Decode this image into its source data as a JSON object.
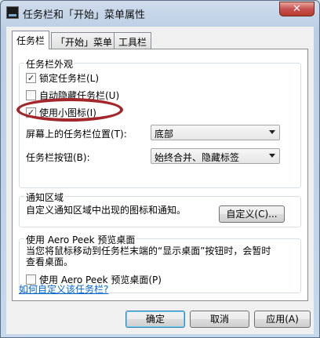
{
  "window": {
    "title": "任务栏和「开始」菜单属性",
    "close_glyph": "✕"
  },
  "tabs": [
    {
      "label": "任务栏"
    },
    {
      "label": "「开始」菜单"
    },
    {
      "label": "工具栏"
    }
  ],
  "appearance": {
    "legend": "任务栏外观",
    "lock_label": "锁定任务栏(L)",
    "lock_checked": true,
    "autohide_label": "自动隐藏任务栏(U)",
    "autohide_checked": false,
    "small_icons_label": "使用小图标(I)",
    "small_icons_checked": true,
    "position_label": "屏幕上的任务栏位置(T):",
    "position_value": "底部",
    "buttons_label": "任务栏按钮(B):",
    "buttons_value": "始终合并、隐藏标签"
  },
  "notification": {
    "legend": "通知区域",
    "desc": "自定义通知区域中出现的图标和通知。",
    "customize_button": "自定义(C)..."
  },
  "aero_peek": {
    "legend": "使用 Aero Peek 预览桌面",
    "desc": "当您将鼠标移动到任务栏末端的“显示桌面”按钮时，会暂时查看桌面。",
    "checkbox_label": "使用 Aero Peek 预览桌面(P)",
    "checkbox_checked": false
  },
  "help_link": "如何自定义该任务栏?",
  "footer": {
    "ok": "确定",
    "cancel": "取消",
    "apply": "应用(A)"
  },
  "checkmark": "✓",
  "colors": {
    "highlight_ellipse": "#a3262b",
    "link": "#0066cc",
    "close_button": "#c75050"
  }
}
